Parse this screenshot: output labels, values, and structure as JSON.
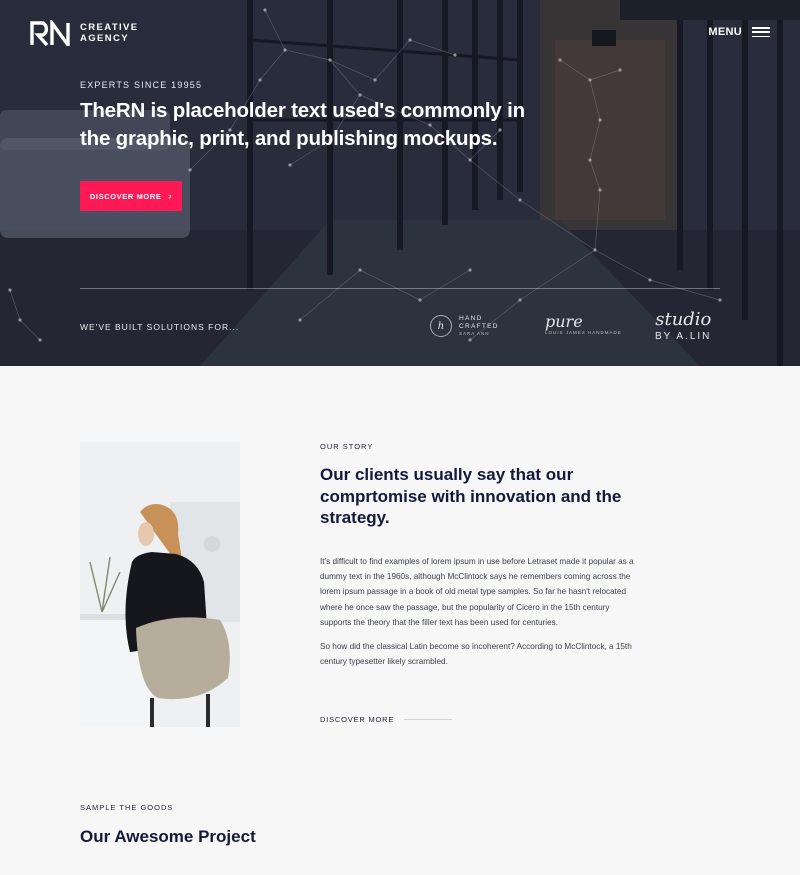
{
  "logo": {
    "line1": "CREATIVE",
    "line2": "AGENCY"
  },
  "nav": {
    "menu_label": "MENU"
  },
  "hero": {
    "eyebrow": "EXPERTS SINCE 19955",
    "headline": "TheRN is placeholder text used's commonly in the graphic, print, and publishing mockups.",
    "cta_label": "DISCOVER MORE",
    "cta_icon": "chevron-right-icon",
    "built_label": "WE'VE BUILT SOLUTIONS FOR..."
  },
  "clients": {
    "handcrafted": {
      "badge": "h",
      "line1": "HAND",
      "line2": "CRAFTED",
      "sub": "SARA ANN"
    },
    "pure": {
      "word": "pure",
      "sub": "LOUIS JAMES HANDMADE"
    },
    "studio": {
      "word": "studio",
      "sub": "BY A.LIN"
    }
  },
  "story": {
    "label": "OUR STORY",
    "heading": "Our clients usually say that our comprtomise with innovation and the strategy.",
    "paragraph1": "It's difficult to find examples of lorem ipsum in use before Letraset made it popular as a dummy text in the 1960s, although McClintock says he remembers coming across the lorem ipsum passage in a book of old metal type samples. So far he hasn't relocated where he once saw the passage, but the popularity of Cicero in the 15th century supports the theory that the filler text has been used for centuries.",
    "paragraph2": "So how did the classical Latin become so incoherent? According to McClintock, a 15th century typesetter likely scrambled.",
    "link_label": "DISCOVER MORE"
  },
  "projects": {
    "label": "SAMPLE THE GOODS",
    "heading": "Our Awesome Project"
  },
  "colors": {
    "accent": "#ff1a56",
    "heading": "#13193a",
    "hero_overlay": "#2c3140",
    "page_bg": "#f7f7f7"
  }
}
